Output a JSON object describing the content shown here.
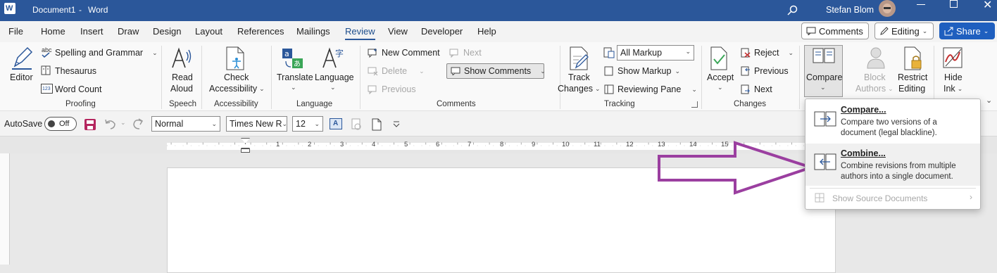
{
  "window": {
    "doc_title": "Document1",
    "separator": "-",
    "app_name": "Word",
    "user_name": "Stefan Blom"
  },
  "tabs": [
    "File",
    "Home",
    "Insert",
    "Draw",
    "Design",
    "Layout",
    "References",
    "Mailings",
    "Review",
    "View",
    "Developer",
    "Help"
  ],
  "active_tab": "Review",
  "top_buttons": {
    "comments": "Comments",
    "editing": "Editing",
    "share": "Share"
  },
  "ribbon": {
    "proofing": {
      "editor": "Editor",
      "spelling": "Spelling and Grammar",
      "thesaurus": "Thesaurus",
      "word_count": "Word Count",
      "group": "Proofing",
      "abc": "abc",
      "num": "123"
    },
    "speech": {
      "read": "Read",
      "aloud": "Aloud",
      "group": "Speech"
    },
    "accessibility": {
      "check": "Check",
      "accessibility": "Accessibility",
      "group": "Accessibility"
    },
    "language": {
      "translate": "Translate",
      "language": "Language",
      "group": "Language"
    },
    "comments": {
      "new_comment": "New Comment",
      "delete": "Delete",
      "previous": "Previous",
      "next": "Next",
      "show_comments": "Show Comments",
      "group": "Comments"
    },
    "tracking": {
      "track": "Track",
      "changes": "Changes",
      "all_markup": "All Markup",
      "show_markup": "Show Markup",
      "reviewing_pane": "Reviewing Pane",
      "group": "Tracking"
    },
    "changes": {
      "accept": "Accept",
      "reject": "Reject",
      "previous": "Previous",
      "next": "Next",
      "group": "Changes"
    },
    "compare": {
      "label": "Compare"
    },
    "protect": {
      "block": "Block",
      "authors": "Authors",
      "restrict": "Restrict",
      "editing": "Editing"
    },
    "ink": {
      "hide": "Hide",
      "ink": "Ink"
    }
  },
  "quick_toolbar": {
    "autosave": "AutoSave",
    "toggle": "Off",
    "style": "Normal",
    "font": "Times New R",
    "size": "12"
  },
  "ruler": {
    "numbers": [
      "1",
      "2",
      "3",
      "4",
      "5",
      "6",
      "7",
      "8",
      "9",
      "10",
      "11",
      "12",
      "13",
      "14",
      "15"
    ]
  },
  "compare_menu": {
    "compare_title": "Compare...",
    "compare_desc": "Compare two versions of a document (legal blackline).",
    "combine_title": "Combine...",
    "combine_desc": "Combine revisions from multiple authors into a single document.",
    "show_source": "Show Source Documents"
  },
  "colors": {
    "titlebar": "#2b579a",
    "share": "#1f5fbf",
    "annotation_arrow": "#9b3fa0"
  }
}
